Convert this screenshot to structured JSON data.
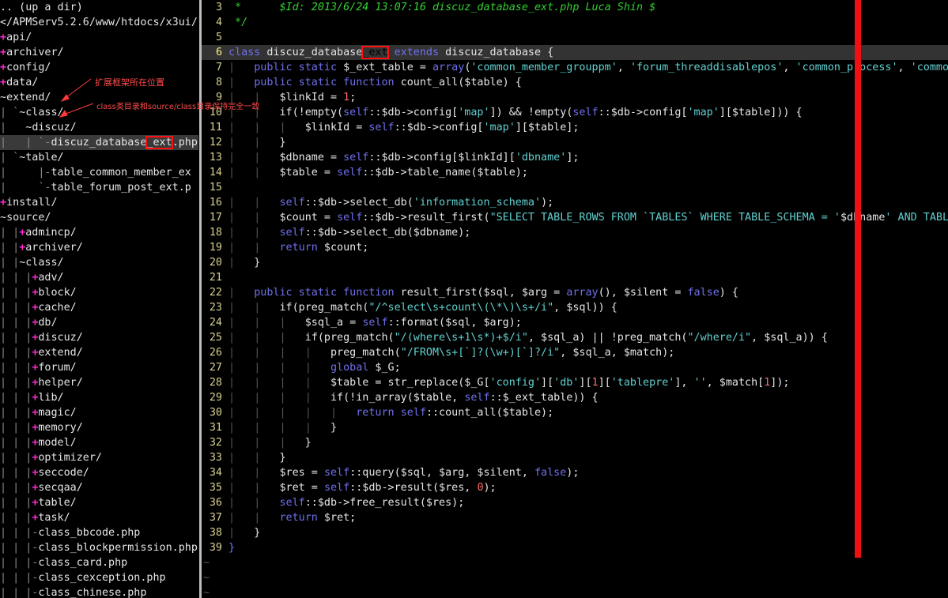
{
  "tree": {
    "up_dir": ".. (up a dir)",
    "root_path": "</APMServ5.2.6/www/htdocs/x3ui/",
    "items": [
      {
        "indent": "",
        "prefix": "+",
        "name": "api/"
      },
      {
        "indent": "",
        "prefix": "+",
        "name": "archiver/"
      },
      {
        "indent": "",
        "prefix": "+",
        "name": "config/"
      },
      {
        "indent": "",
        "prefix": "+",
        "name": "data/"
      },
      {
        "indent": "",
        "prefix": "~",
        "name": "extend/"
      },
      {
        "indent": "| `",
        "prefix": "~",
        "name": "class/"
      },
      {
        "indent": "|   ",
        "prefix": "~",
        "name": "discuz/"
      },
      {
        "indent": "|   | `-",
        "prefix": "",
        "name": "discuz_database_ext.php"
      },
      {
        "indent": "| `",
        "prefix": "~",
        "name": "table/"
      },
      {
        "indent": "|     |-",
        "prefix": "",
        "name": "table_common_member_ex"
      },
      {
        "indent": "|     `-",
        "prefix": "",
        "name": "table_forum_post_ext.p"
      },
      {
        "indent": "",
        "prefix": "+",
        "name": "install/"
      },
      {
        "indent": "",
        "prefix": "~",
        "name": "source/"
      },
      {
        "indent": "| |",
        "prefix": "+",
        "name": "admincp/"
      },
      {
        "indent": "| |",
        "prefix": "+",
        "name": "archiver/"
      },
      {
        "indent": "| |",
        "prefix": "~",
        "name": "class/"
      },
      {
        "indent": "| | |",
        "prefix": "+",
        "name": "adv/"
      },
      {
        "indent": "| | |",
        "prefix": "+",
        "name": "block/"
      },
      {
        "indent": "| | |",
        "prefix": "+",
        "name": "cache/"
      },
      {
        "indent": "| | |",
        "prefix": "+",
        "name": "db/"
      },
      {
        "indent": "| | |",
        "prefix": "+",
        "name": "discuz/"
      },
      {
        "indent": "| | |",
        "prefix": "+",
        "name": "extend/"
      },
      {
        "indent": "| | |",
        "prefix": "+",
        "name": "forum/"
      },
      {
        "indent": "| | |",
        "prefix": "+",
        "name": "helper/"
      },
      {
        "indent": "| | |",
        "prefix": "+",
        "name": "lib/"
      },
      {
        "indent": "| | |",
        "prefix": "+",
        "name": "magic/"
      },
      {
        "indent": "| | |",
        "prefix": "+",
        "name": "memory/"
      },
      {
        "indent": "| | |",
        "prefix": "+",
        "name": "model/"
      },
      {
        "indent": "| | |",
        "prefix": "+",
        "name": "optimizer/"
      },
      {
        "indent": "| | |",
        "prefix": "+",
        "name": "seccode/"
      },
      {
        "indent": "| | |",
        "prefix": "+",
        "name": "secqaa/"
      },
      {
        "indent": "| | |",
        "prefix": "+",
        "name": "table/"
      },
      {
        "indent": "| | |",
        "prefix": "+",
        "name": "task/"
      },
      {
        "indent": "| | |-",
        "prefix": "",
        "name": "class_bbcode.php"
      },
      {
        "indent": "| | |-",
        "prefix": "",
        "name": "class_blockpermission.php"
      },
      {
        "indent": "| | |-",
        "prefix": "",
        "name": "class_card.php"
      },
      {
        "indent": "| | |-",
        "prefix": "",
        "name": "class_cexception.php"
      },
      {
        "indent": "| | |-",
        "prefix": "",
        "name": "class_chinese.php"
      }
    ]
  },
  "annotations": {
    "note1": "扩展框架所在位置",
    "note2": "class类目录和source/class目录保持完全一致"
  },
  "code": {
    "current_line": 6,
    "lines": [
      {
        "n": "3",
        "segs": [
          [
            "cmt",
            " *      $Id: 2013/6/24 13:07:16 discuz_database_ext.php Luca Shin $"
          ]
        ]
      },
      {
        "n": "4",
        "segs": [
          [
            "cmt",
            " */"
          ]
        ]
      },
      {
        "n": "5",
        "segs": []
      },
      {
        "n": "6",
        "segs": [
          [
            "kw",
            "class"
          ],
          [
            "pln",
            " discuz_database"
          ],
          [
            "hi",
            "_ext"
          ],
          [
            "pln",
            " "
          ],
          [
            "kw",
            "extends"
          ],
          [
            "pln",
            " discuz_database {"
          ]
        ]
      },
      {
        "n": "7",
        "segs": [
          [
            "ig",
            "|   "
          ],
          [
            "kw",
            "public static"
          ],
          [
            "pln",
            " $_ext_table = "
          ],
          [
            "kw",
            "array"
          ],
          [
            "pln",
            "("
          ],
          [
            "str",
            "'common_member_grouppm'"
          ],
          [
            "pln",
            ", "
          ],
          [
            "str",
            "'forum_threaddisablepos'"
          ],
          [
            "pln",
            ", "
          ],
          [
            "str",
            "'common_process'"
          ],
          [
            "pln",
            ", "
          ],
          [
            "str",
            "'common"
          ]
        ]
      },
      {
        "n": "8",
        "segs": [
          [
            "ig",
            "|   "
          ],
          [
            "kw",
            "public static function"
          ],
          [
            "pln",
            " count_all($table) {"
          ]
        ]
      },
      {
        "n": "9",
        "segs": [
          [
            "ig",
            "|   |   "
          ],
          [
            "pln",
            "$linkId = "
          ],
          [
            "num",
            "1"
          ],
          [
            "pln",
            ";"
          ]
        ]
      },
      {
        "n": "10",
        "segs": [
          [
            "ig",
            "|   |   "
          ],
          [
            "pln",
            "if(!empty("
          ],
          [
            "kw",
            "self"
          ],
          [
            "pln",
            "::$db->config["
          ],
          [
            "str",
            "'map'"
          ],
          [
            "pln",
            "]) && !empty("
          ],
          [
            "kw",
            "self"
          ],
          [
            "pln",
            "::$db->config["
          ],
          [
            "str",
            "'map'"
          ],
          [
            "pln",
            "][$table])) {"
          ]
        ]
      },
      {
        "n": "11",
        "segs": [
          [
            "ig",
            "|   |   |   "
          ],
          [
            "pln",
            "$linkId = "
          ],
          [
            "kw",
            "self"
          ],
          [
            "pln",
            "::$db->config["
          ],
          [
            "str",
            "'map'"
          ],
          [
            "pln",
            "][$table];"
          ]
        ]
      },
      {
        "n": "12",
        "segs": [
          [
            "ig",
            "|   |   "
          ],
          [
            "pln",
            "}"
          ]
        ]
      },
      {
        "n": "13",
        "segs": [
          [
            "ig",
            "|   |   "
          ],
          [
            "pln",
            "$dbname = "
          ],
          [
            "kw",
            "self"
          ],
          [
            "pln",
            "::$db->config[$linkId]["
          ],
          [
            "str",
            "'dbname'"
          ],
          [
            "pln",
            "];"
          ]
        ]
      },
      {
        "n": "14",
        "segs": [
          [
            "ig",
            "|   |   "
          ],
          [
            "pln",
            "$table = "
          ],
          [
            "kw",
            "self"
          ],
          [
            "pln",
            "::$db->table_name($table);"
          ]
        ]
      },
      {
        "n": "15",
        "segs": []
      },
      {
        "n": "16",
        "segs": [
          [
            "ig",
            "|   |   "
          ],
          [
            "kw",
            "self"
          ],
          [
            "pln",
            "::$db->select_db("
          ],
          [
            "str",
            "'information_schema'"
          ],
          [
            "pln",
            ");"
          ]
        ]
      },
      {
        "n": "17",
        "segs": [
          [
            "ig",
            "|   |   "
          ],
          [
            "pln",
            "$count = "
          ],
          [
            "kw",
            "self"
          ],
          [
            "pln",
            "::$db->result_first("
          ],
          [
            "str",
            "\"SELECT TABLE_ROWS FROM `TABLES` WHERE TABLE_SCHEMA = '"
          ],
          [
            "pln",
            "$dbname"
          ],
          [
            "str",
            "' AND TABLE"
          ]
        ]
      },
      {
        "n": "18",
        "segs": [
          [
            "ig",
            "|   |   "
          ],
          [
            "kw",
            "self"
          ],
          [
            "pln",
            "::$db->select_db($dbname);"
          ]
        ]
      },
      {
        "n": "19",
        "segs": [
          [
            "ig",
            "|   |   "
          ],
          [
            "kw",
            "return"
          ],
          [
            "pln",
            " $count;"
          ]
        ]
      },
      {
        "n": "20",
        "segs": [
          [
            "ig",
            "|   "
          ],
          [
            "pln",
            "}"
          ]
        ]
      },
      {
        "n": "21",
        "segs": []
      },
      {
        "n": "22",
        "segs": [
          [
            "ig",
            "|   "
          ],
          [
            "kw",
            "public static function"
          ],
          [
            "pln",
            " result_first($sql, $arg = "
          ],
          [
            "kw",
            "array"
          ],
          [
            "pln",
            "(), $silent = "
          ],
          [
            "kw",
            "false"
          ],
          [
            "pln",
            ") {"
          ]
        ]
      },
      {
        "n": "23",
        "segs": [
          [
            "ig",
            "|   |   "
          ],
          [
            "pln",
            "if(preg_match("
          ],
          [
            "str",
            "\"/^select\\s+count\\(\\*\\)\\s+/i\""
          ],
          [
            "pln",
            ", $sql)) {"
          ]
        ]
      },
      {
        "n": "24",
        "segs": [
          [
            "ig",
            "|   |   |   "
          ],
          [
            "pln",
            "$sql_a = "
          ],
          [
            "kw",
            "self"
          ],
          [
            "pln",
            "::format($sql, $arg);"
          ]
        ]
      },
      {
        "n": "25",
        "segs": [
          [
            "ig",
            "|   |   |   "
          ],
          [
            "pln",
            "if(preg_match("
          ],
          [
            "str",
            "\"/(where\\s+1\\s*)+$/i\""
          ],
          [
            "pln",
            ", $sql_a) || !preg_match("
          ],
          [
            "str",
            "\"/where/i\""
          ],
          [
            "pln",
            ", $sql_a)) {"
          ]
        ]
      },
      {
        "n": "26",
        "segs": [
          [
            "ig",
            "|   |   |   |   "
          ],
          [
            "pln",
            "preg_match("
          ],
          [
            "str",
            "\"/FROM\\s+[`]?(\\w+)[`]?/i\""
          ],
          [
            "pln",
            ", $sql_a, $match);"
          ]
        ]
      },
      {
        "n": "27",
        "segs": [
          [
            "ig",
            "|   |   |   |   "
          ],
          [
            "kw",
            "global"
          ],
          [
            "pln",
            " $_G;"
          ]
        ]
      },
      {
        "n": "28",
        "segs": [
          [
            "ig",
            "|   |   |   |   "
          ],
          [
            "pln",
            "$table = str_replace($_G["
          ],
          [
            "str",
            "'config'"
          ],
          [
            "pln",
            "]["
          ],
          [
            "str",
            "'db'"
          ],
          [
            "pln",
            "]["
          ],
          [
            "num",
            "1"
          ],
          [
            "pln",
            "]["
          ],
          [
            "str",
            "'tablepre'"
          ],
          [
            "pln",
            "], "
          ],
          [
            "str",
            "''"
          ],
          [
            "pln",
            ", $match["
          ],
          [
            "num",
            "1"
          ],
          [
            "pln",
            "]);"
          ]
        ]
      },
      {
        "n": "29",
        "segs": [
          [
            "ig",
            "|   |   |   |   "
          ],
          [
            "pln",
            "if(!in_array($table, "
          ],
          [
            "kw",
            "self"
          ],
          [
            "pln",
            "::$_ext_table)) {"
          ]
        ]
      },
      {
        "n": "30",
        "segs": [
          [
            "ig",
            "|   |   |   |   |   "
          ],
          [
            "kw",
            "return self"
          ],
          [
            "pln",
            "::count_all($table);"
          ]
        ]
      },
      {
        "n": "31",
        "segs": [
          [
            "ig",
            "|   |   |   |   "
          ],
          [
            "pln",
            "}"
          ]
        ]
      },
      {
        "n": "32",
        "segs": [
          [
            "ig",
            "|   |   |   "
          ],
          [
            "pln",
            "}"
          ]
        ]
      },
      {
        "n": "33",
        "segs": [
          [
            "ig",
            "|   |   "
          ],
          [
            "pln",
            "}"
          ]
        ]
      },
      {
        "n": "34",
        "segs": [
          [
            "ig",
            "|   |   "
          ],
          [
            "pln",
            "$res = "
          ],
          [
            "kw",
            "self"
          ],
          [
            "pln",
            "::query($sql, $arg, $silent, "
          ],
          [
            "kw",
            "false"
          ],
          [
            "pln",
            ");"
          ]
        ]
      },
      {
        "n": "35",
        "segs": [
          [
            "ig",
            "|   |   "
          ],
          [
            "pln",
            "$ret = "
          ],
          [
            "kw",
            "self"
          ],
          [
            "pln",
            "::$db->result($res, "
          ],
          [
            "num",
            "0"
          ],
          [
            "pln",
            ");"
          ]
        ]
      },
      {
        "n": "36",
        "segs": [
          [
            "ig",
            "|   |   "
          ],
          [
            "kw",
            "self"
          ],
          [
            "pln",
            "::$db->free_result($res);"
          ]
        ]
      },
      {
        "n": "37",
        "segs": [
          [
            "ig",
            "|   |   "
          ],
          [
            "kw",
            "return"
          ],
          [
            "pln",
            " $ret;"
          ]
        ]
      },
      {
        "n": "38",
        "segs": [
          [
            "ig",
            "|   "
          ],
          [
            "pln",
            "}"
          ]
        ]
      },
      {
        "n": "39",
        "segs": [
          [
            "kw2",
            "}"
          ]
        ]
      }
    ],
    "filler": "~"
  }
}
